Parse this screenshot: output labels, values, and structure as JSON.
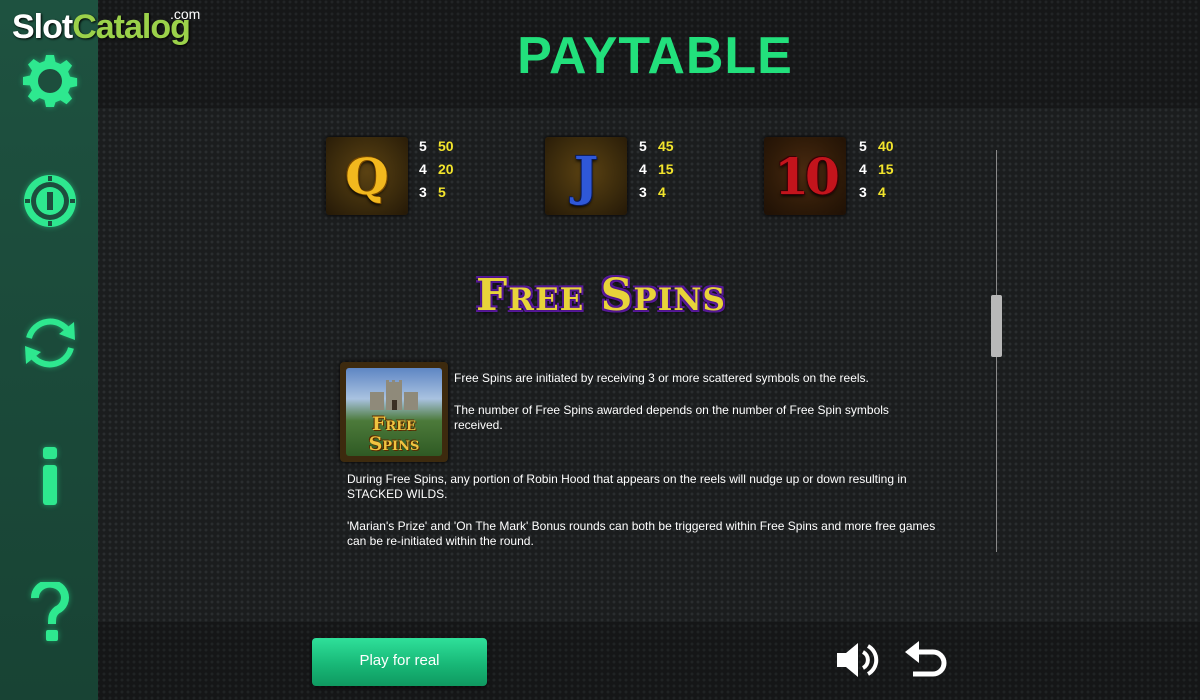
{
  "logo": {
    "slot": "Slot",
    "catalog": "Catalog",
    "com": ".com"
  },
  "title": "PAYTABLE",
  "sidebar": {
    "icons": [
      "gear-icon",
      "coin-icon",
      "refresh-icon",
      "info-icon",
      "help-icon"
    ],
    "info_label": "i",
    "help_label": "?"
  },
  "symbols": [
    {
      "label": "Q",
      "color": "#f2b81e",
      "pays": [
        {
          "count": "5",
          "win": "50"
        },
        {
          "count": "4",
          "win": "20"
        },
        {
          "count": "3",
          "win": "5"
        }
      ]
    },
    {
      "label": "J",
      "color": "#2f58d8",
      "pays": [
        {
          "count": "5",
          "win": "45"
        },
        {
          "count": "4",
          "win": "15"
        },
        {
          "count": "3",
          "win": "4"
        }
      ]
    },
    {
      "label": "10",
      "color": "#c3141c",
      "pays": [
        {
          "count": "5",
          "win": "40"
        },
        {
          "count": "4",
          "win": "15"
        },
        {
          "count": "3",
          "win": "4"
        }
      ]
    }
  ],
  "free_spins": {
    "heading": "Free Spins",
    "symbol_line1": "Free",
    "symbol_line2": "Spins",
    "p1": "Free Spins are initiated by receiving 3 or more scattered symbols on the reels.",
    "p2": "The number of Free Spins awarded depends on the number of Free Spin symbols received.",
    "p3": "During Free Spins, any portion of Robin Hood that appears on the reels will nudge up or down resulting in STACKED WILDS.",
    "p4": "'Marian's Prize' and 'On The Mark' Bonus rounds can both be triggered within Free Spins and more free games can be re-initiated within the round."
  },
  "footer": {
    "play_label": "Play for real"
  },
  "colors": {
    "accent": "#22e07c",
    "pay_value": "#f3e52c",
    "sidebar": "#1e5240"
  }
}
